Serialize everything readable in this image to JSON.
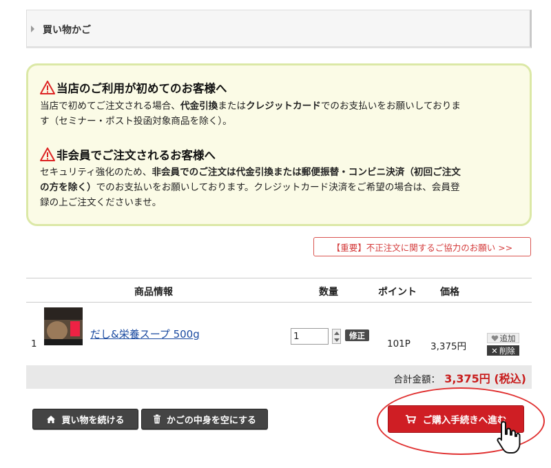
{
  "header": {
    "title": "買い物かご"
  },
  "notice": {
    "first_title": "当店のご利用が初めてのお客様へ",
    "first_line1_a": "当店で初めてご注文される場合、",
    "first_line1_b": "代金引換",
    "first_line1_c": "または",
    "first_line1_d": "クレジットカード",
    "first_line1_e": "でのお支払いをお願いしておりま",
    "first_line2": "す（セミナー・ポスト投函対象商品を除く）。",
    "guest_title": "非会員でご注文されるお客様へ",
    "guest_line1_a": "セキュリティ強化のため、",
    "guest_line1_b": "非会員でのご注文は代金引換または郵便振替・コンビニ決済（初回ご注文",
    "guest_line2_a": "の方を除く）",
    "guest_line2_b": "でのお支払いをお願いしております。クレジットカード決済をご希望の場合は、会員登",
    "guest_line3": "録の上ご注文くださいませ。"
  },
  "important_link": "【重要】不正注文に関するご協力のお願い >>",
  "table": {
    "headers": {
      "product": "商品情報",
      "qty": "数量",
      "points": "ポイント",
      "price": "価格"
    },
    "rows": [
      {
        "num": "1",
        "name": "だし&栄養スープ 500g",
        "qty": "1",
        "fix": "修正",
        "points": "101P",
        "price": "3,375円",
        "add": "追加",
        "delete": "削除"
      }
    ]
  },
  "total": {
    "label": "合計金額：",
    "amount": "3,375円 (税込)"
  },
  "buttons": {
    "continue": "買い物を続ける",
    "empty": "かごの中身を空にする",
    "checkout": "ご購入手続きへ進む"
  },
  "colors": {
    "accent_red": "#cf1e24",
    "notice_border": "#dbe8a6",
    "link_blue": "#1a4aa0"
  }
}
